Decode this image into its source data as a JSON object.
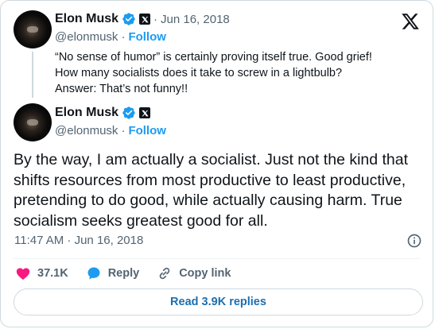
{
  "quoted": {
    "name": "Elon Musk",
    "handle": "@elonmusk",
    "date": "Jun 16, 2018",
    "follow_label": "Follow",
    "text_lines": [
      "“No sense of humor” is certainly proving itself true. Good grief!",
      "How many socialists does it take to screw in a lightbulb?",
      "Answer: That’s not funny!!"
    ]
  },
  "main": {
    "name": "Elon Musk",
    "handle": "@elonmusk",
    "follow_label": "Follow",
    "text_lines": [
      "By the way, I am actually a socialist. Just not the kind that",
      "shifts resources from most productive to least productive,",
      "pretending to do good, while actually causing harm. True",
      "socialism seeks greatest good for all."
    ],
    "timestamp": "11:47 AM · Jun 16, 2018"
  },
  "actions": {
    "like_count": "37.1K",
    "reply_label": "Reply",
    "copy_label": "Copy link"
  },
  "replies_button": "Read 3.9K replies",
  "colors": {
    "accent": "#1d9bf0",
    "like": "#f91880",
    "text": "#0f1419",
    "muted": "#536471"
  },
  "icons": [
    "verified-badge-icon",
    "x-badge-icon",
    "x-logo-icon",
    "info-icon",
    "heart-icon",
    "reply-icon",
    "link-icon"
  ]
}
